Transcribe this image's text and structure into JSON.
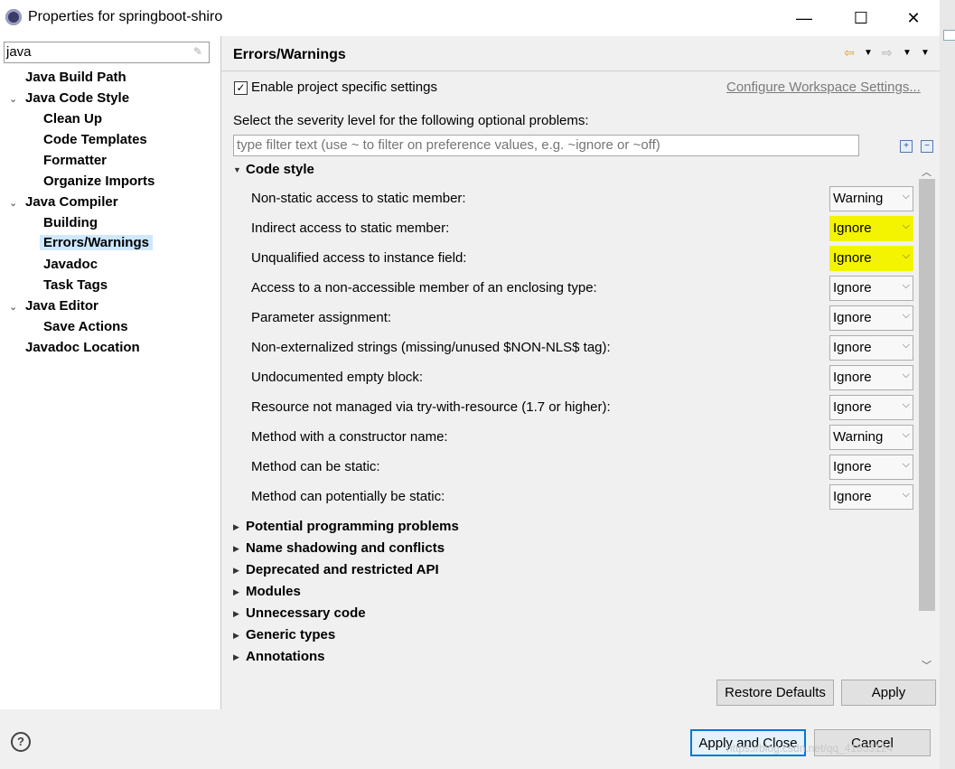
{
  "window": {
    "title": "Properties for springboot-shiro",
    "minimize": "—",
    "maximize": "☐",
    "close": "✕"
  },
  "left": {
    "filter_value": "java",
    "tree": [
      {
        "label": "Java Build Path"
      },
      {
        "label": "Java Code Style"
      },
      {
        "label": "Clean Up"
      },
      {
        "label": "Code Templates"
      },
      {
        "label": "Formatter"
      },
      {
        "label": "Organize Imports"
      },
      {
        "label": "Java Compiler"
      },
      {
        "label": "Building"
      },
      {
        "label": "Errors/Warnings"
      },
      {
        "label": "Javadoc"
      },
      {
        "label": "Task Tags"
      },
      {
        "label": "Java Editor"
      },
      {
        "label": "Save Actions"
      },
      {
        "label": "Javadoc Location"
      }
    ],
    "selected": "Errors/Warnings"
  },
  "main": {
    "title": "Errors/Warnings",
    "enable_label": "Enable project specific settings",
    "enable_checked": true,
    "configure_link": "Configure Workspace Settings...",
    "severity_label": "Select the severity level for the following optional problems:",
    "filter_placeholder": "type filter text (use ~ to filter on preference values, e.g. ~ignore or ~off)",
    "expanded_section": "Code style",
    "rows": [
      {
        "label": "Non-static access to static member:",
        "value": "Warning"
      },
      {
        "label": "Indirect access to static member:",
        "value": "Ignore",
        "highlight": true
      },
      {
        "label": "Unqualified access to instance field:",
        "value": "Ignore",
        "highlight": true
      },
      {
        "label": "Access to a non-accessible member of an enclosing type:",
        "value": "Ignore"
      },
      {
        "label": "Parameter assignment:",
        "value": "Ignore"
      },
      {
        "label": "Non-externalized strings (missing/unused $NON-NLS$ tag):",
        "value": "Ignore"
      },
      {
        "label": "Undocumented empty block:",
        "value": "Ignore"
      },
      {
        "label": "Resource not managed via try-with-resource (1.7 or higher):",
        "value": "Ignore"
      },
      {
        "label": "Method with a constructor name:",
        "value": "Warning"
      },
      {
        "label": "Method can be static:",
        "value": "Ignore"
      },
      {
        "label": "Method can potentially be static:",
        "value": "Ignore"
      }
    ],
    "collapsed_sections": [
      "Potential programming problems",
      "Name shadowing and conflicts",
      "Deprecated and restricted API",
      "Modules",
      "Unnecessary code",
      "Generic types",
      "Annotations"
    ],
    "restore_defaults": "Restore Defaults",
    "apply": "Apply"
  },
  "footer": {
    "help": "?",
    "apply_and_close": "Apply and Close",
    "cancel": "Cancel",
    "watermark": "https://blog.csdn.net/qq_41553124"
  },
  "colors": {
    "highlight": "#f4f400",
    "selection": "#cde8ff",
    "accent": "#0078d7"
  }
}
